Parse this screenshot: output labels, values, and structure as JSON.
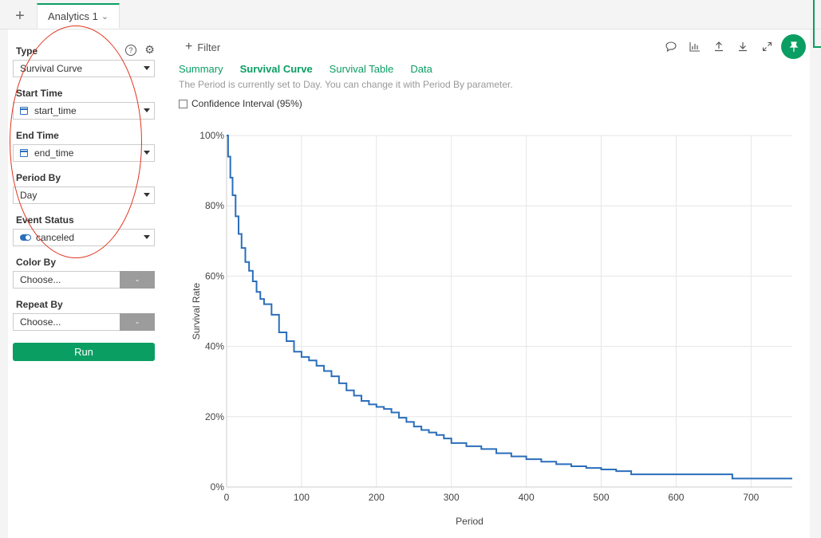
{
  "tabs": {
    "add_label": "+",
    "active_label": "Analytics 1"
  },
  "sidebar": {
    "type_label": "Type",
    "type_value": "Survival Curve",
    "start_time_label": "Start Time",
    "start_time_value": "start_time",
    "end_time_label": "End Time",
    "end_time_value": "end_time",
    "period_by_label": "Period By",
    "period_by_value": "Day",
    "event_status_label": "Event Status",
    "event_status_value": "canceled",
    "color_by_label": "Color By",
    "color_by_value": "Choose...",
    "color_by_button": "-",
    "repeat_by_label": "Repeat By",
    "repeat_by_value": "Choose...",
    "repeat_by_button": "-",
    "run_label": "Run",
    "help_icon": "question-circle-icon",
    "settings_icon": "gear-icon"
  },
  "toolbar": {
    "filter_label": "Filter",
    "icons": [
      "comment-icon",
      "chart-icon",
      "upload-icon",
      "download-icon",
      "expand-icon",
      "pin-icon"
    ]
  },
  "subtabs": [
    {
      "label": "Summary",
      "active": false
    },
    {
      "label": "Survival Curve",
      "active": true
    },
    {
      "label": "Survival Table",
      "active": false
    },
    {
      "label": "Data",
      "active": false
    }
  ],
  "info_text": "The Period is currently set to Day. You can change it with Period By parameter.",
  "confidence_label": "Confidence Interval (95%)",
  "colors": {
    "accent": "#0a9e63",
    "line": "#2a6ebb",
    "annotation": "#e0341e"
  },
  "chart_data": {
    "type": "line",
    "title": "",
    "xlabel": "Period",
    "ylabel": "Survival Rate",
    "xlim": [
      0,
      755
    ],
    "ylim": [
      0,
      1
    ],
    "x_ticks": [
      0,
      100,
      200,
      300,
      400,
      500,
      600,
      700
    ],
    "y_ticks": [
      0,
      0.2,
      0.4,
      0.6,
      0.8,
      1.0
    ],
    "y_tick_labels": [
      "0%",
      "20%",
      "40%",
      "60%",
      "80%",
      "100%"
    ],
    "grid": true,
    "series": [
      {
        "x": [
          0,
          2,
          5,
          8,
          12,
          16,
          20,
          25,
          30,
          35,
          40,
          45,
          50,
          60,
          70,
          80,
          90,
          100,
          110,
          120,
          130,
          140,
          150,
          160,
          170,
          180,
          190,
          200,
          210,
          220,
          230,
          240,
          250,
          260,
          270,
          280,
          290,
          300,
          320,
          340,
          360,
          380,
          400,
          420,
          440,
          460,
          480,
          500,
          520,
          540,
          560,
          600,
          640,
          675,
          700,
          730,
          755
        ],
        "y": [
          1.0,
          0.94,
          0.88,
          0.83,
          0.77,
          0.72,
          0.68,
          0.64,
          0.615,
          0.585,
          0.555,
          0.535,
          0.52,
          0.49,
          0.44,
          0.415,
          0.385,
          0.37,
          0.36,
          0.345,
          0.33,
          0.315,
          0.295,
          0.275,
          0.26,
          0.245,
          0.235,
          0.228,
          0.222,
          0.212,
          0.197,
          0.185,
          0.172,
          0.162,
          0.155,
          0.148,
          0.138,
          0.125,
          0.116,
          0.108,
          0.096,
          0.087,
          0.079,
          0.072,
          0.065,
          0.059,
          0.054,
          0.05,
          0.045,
          0.036,
          0.036,
          0.036,
          0.036,
          0.024,
          0.024,
          0.024,
          0.024
        ]
      }
    ]
  }
}
